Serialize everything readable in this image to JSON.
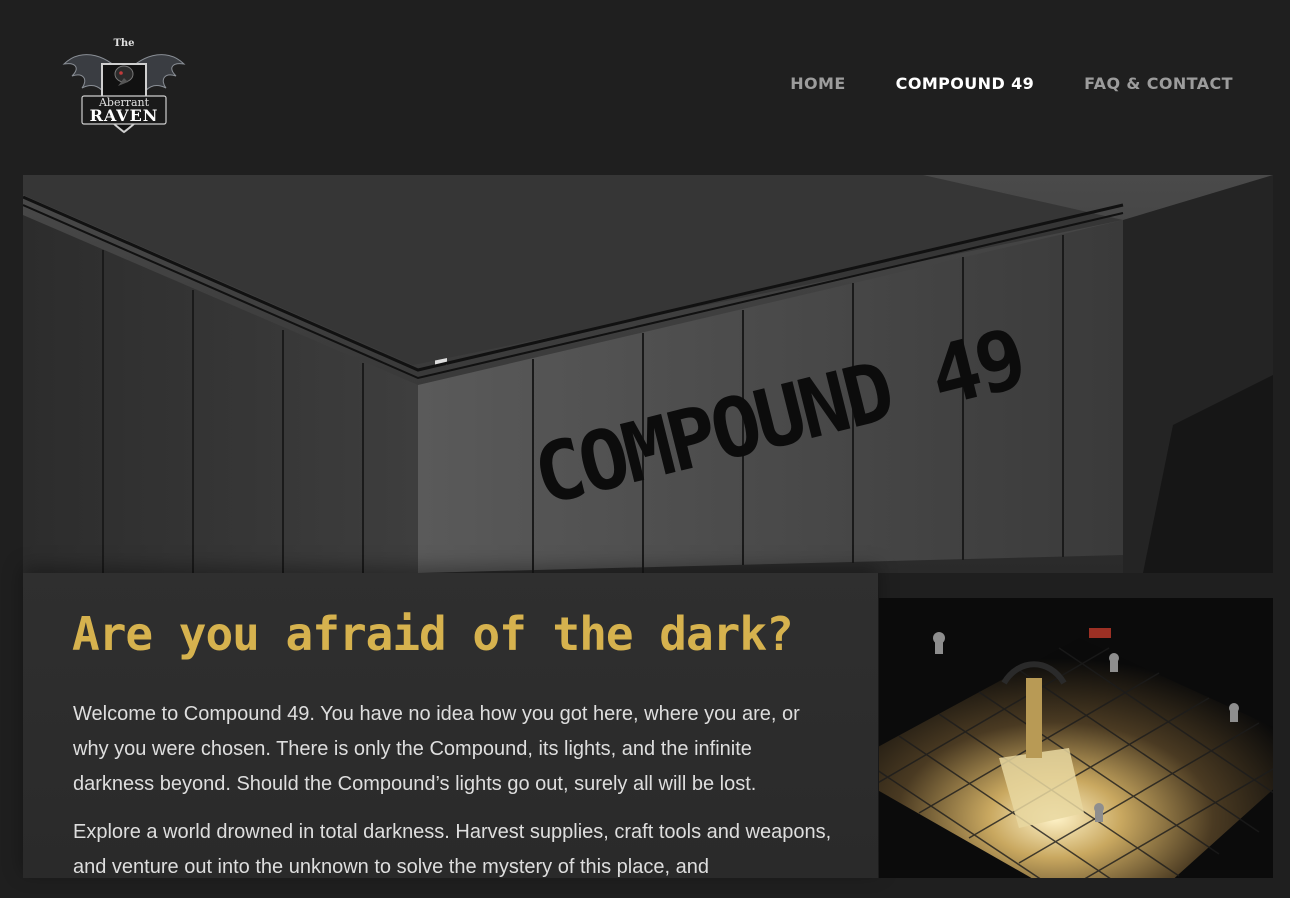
{
  "logo": {
    "line1": "The",
    "line2": "Aberrant",
    "line3": "RAVEN"
  },
  "nav": {
    "items": [
      {
        "label": "HOME",
        "active": false
      },
      {
        "label": "COMPOUND 49",
        "active": true
      },
      {
        "label": "FAQ & CONTACT",
        "active": false
      }
    ]
  },
  "hero": {
    "wall_text": "COMPOUND 49"
  },
  "content": {
    "headline": "Are you afraid of the dark?",
    "paragraphs": [
      "Welcome to Compound 49. You have no idea how you got here, where you are, or why you were chosen. There is only the Compound, its lights, and the infinite darkness beyond. Should the Compound’s lights go out, surely all will be lost.",
      "Explore a world drowned in total darkness. Harvest supplies, craft tools and weapons, and venture out into the unknown to solve the mystery of this place, and"
    ]
  },
  "colors": {
    "page_bg": "#1f1f1f",
    "card_bg": "#2c2c2c",
    "headline": "#d6b24e",
    "nav_active": "#ffffff",
    "nav_inactive": "#9c9c9c",
    "body_text": "#dedede"
  }
}
